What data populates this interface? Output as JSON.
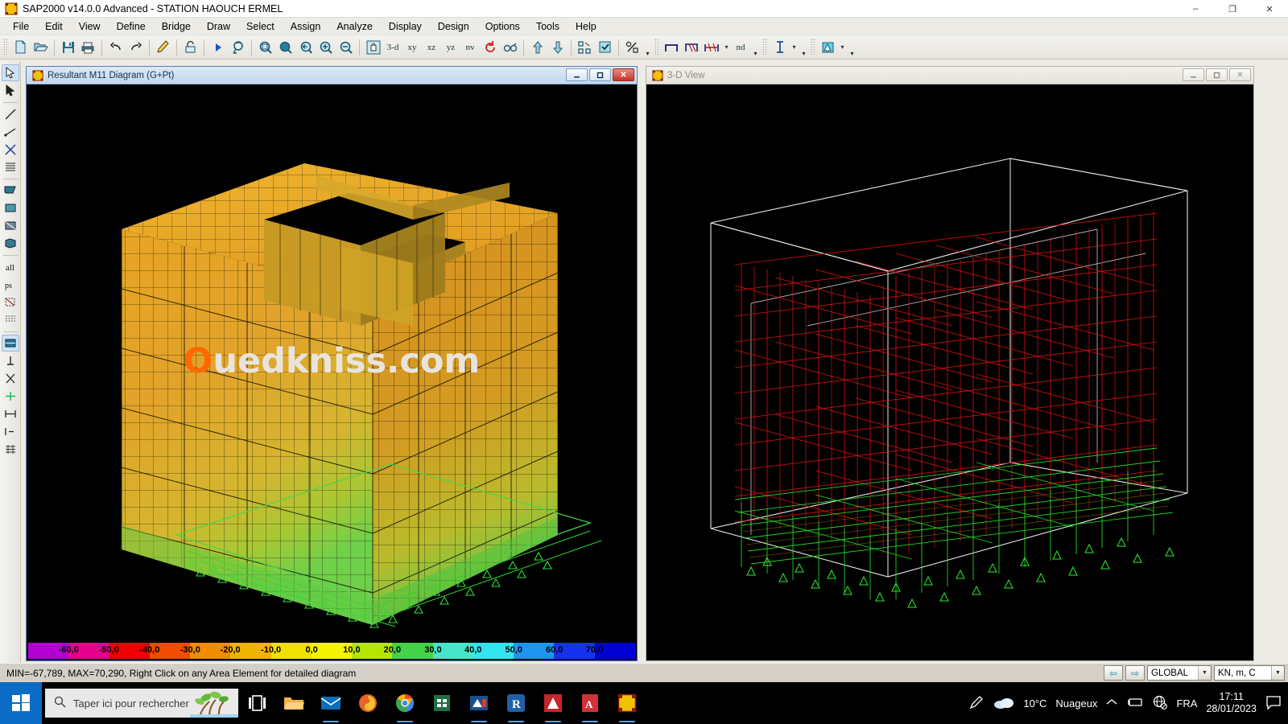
{
  "window": {
    "title": "SAP2000 v14.0.0 Advanced  - STATION HAOUCH ERMEL",
    "app_icon": "sap2000-icon",
    "minimize": "–",
    "maximize": "❐",
    "close": "✕"
  },
  "menu": {
    "items": [
      {
        "label": "File",
        "accel": "F"
      },
      {
        "label": "Edit",
        "accel": "E"
      },
      {
        "label": "View",
        "accel": "V"
      },
      {
        "label": "Define",
        "accel": "D"
      },
      {
        "label": "Bridge",
        "accel": "B"
      },
      {
        "label": "Draw",
        "accel": "a"
      },
      {
        "label": "Select",
        "accel": "S"
      },
      {
        "label": "Assign",
        "accel": "A"
      },
      {
        "label": "Analyze",
        "accel": "n"
      },
      {
        "label": "Display",
        "accel": "y"
      },
      {
        "label": "Design",
        "accel": "g"
      },
      {
        "label": "Options",
        "accel": "O"
      },
      {
        "label": "Tools",
        "accel": "T"
      },
      {
        "label": "Help",
        "accel": "H"
      }
    ]
  },
  "toolbar": {
    "view_3d_label": "3-d",
    "view_xy_label": "xy",
    "view_xz_label": "xz",
    "view_yz_label": "yz",
    "view_nv_label": "nv",
    "view_nd_label": "nd",
    "icons": [
      "new-file-icon",
      "open-folder-icon",
      "save-icon",
      "print-icon",
      "undo-icon",
      "redo-icon",
      "refresh-pencil-icon",
      "lock-icon",
      "run-analysis-icon",
      "rubber-band-zoom-icon",
      "zoom-in-icon",
      "zoom-out-icon",
      "previous-zoom-icon",
      "zoom-full-icon",
      "zoom-window-icon",
      "pan-icon",
      "move-up-icon",
      "move-down-icon",
      "set-elements-icon",
      "display-options-icon",
      "scale-icon",
      "moment-diagram-icon",
      "shear-diagram-icon",
      "axial-diagram-icon",
      "section-cut-icon",
      "assign-frame-icon",
      "fill-icon"
    ]
  },
  "left_rail": {
    "icons": [
      "pointer-icon",
      "select-pointer-icon",
      "draw-line-icon",
      "draw-frame-icon",
      "draw-special-joint-icon",
      "quick-draw-line-icon",
      "draw-area-icon",
      "quick-draw-area-icon",
      "draw-section-icon",
      "select-all-icon",
      "select-previous-icon",
      "deselect-icon",
      "clear-selection-icon",
      "assign-joint-icon",
      "assign-restraint-icon",
      "mesh-icon",
      "constraint-icon",
      "divide-icon",
      "snap-icon",
      "snap-mid-icon",
      "snap-intersection-icon",
      "snap-perpendicular-icon",
      "snap-grid-icon"
    ]
  },
  "left_window": {
    "title": "Resultant M11 Diagram   (G+Pt)",
    "icon": "sap2000-icon",
    "active": true,
    "buttons": {
      "minimize": "–",
      "restore": "❐",
      "close": "✕"
    }
  },
  "right_window": {
    "title": "3-D View",
    "icon": "sap2000-icon",
    "active": false,
    "buttons": {
      "minimize": "–",
      "restore": "❐",
      "close": "✕"
    }
  },
  "watermark": {
    "prefix": "O",
    "rest": "uedkniss.com",
    "accent_color": "#ff6a00"
  },
  "legend": {
    "labels": [
      "-60,0",
      "-50,0",
      "-40,0",
      "-30,0",
      "-20,0",
      "-10,0",
      "0,0",
      "10,0",
      "20,0",
      "30,0",
      "40,0",
      "50,0",
      "60,0",
      "70,0"
    ],
    "colors": [
      "#b400d2",
      "#e6008c",
      "#f00000",
      "#f04b00",
      "#f08c00",
      "#f0b400",
      "#f0e100",
      "#f5f500",
      "#b4e600",
      "#46d246",
      "#46e6c8",
      "#32e6f0",
      "#1e96f0",
      "#1432f0",
      "#0000d2"
    ]
  },
  "status": {
    "message": "MIN=-67,789, MAX=70,290, Right Click on any Area Element for detailed diagram",
    "coord_system": "GLOBAL",
    "units": "KN, m, C",
    "nav_back": "⇦",
    "nav_forward": "⇨"
  },
  "taskbar": {
    "start": "windows-start-icon",
    "search_placeholder": "Taper ici pour rechercher",
    "task_view": "task-view-icon",
    "apps": [
      {
        "name": "file-explorer-icon",
        "running": false
      },
      {
        "name": "mail-icon",
        "running": true
      },
      {
        "name": "firefox-icon",
        "running": false
      },
      {
        "name": "google-chrome-icon",
        "running": true
      },
      {
        "name": "excel-icon",
        "running": false
      },
      {
        "name": "autocad-icon",
        "running": true
      },
      {
        "name": "rstudio-icon",
        "running": true
      },
      {
        "name": "autodesk-icon",
        "running": true
      },
      {
        "name": "adobe-reader-icon",
        "running": true
      },
      {
        "name": "sap2000-icon",
        "running": true
      }
    ],
    "tray": {
      "pen_icon": "pen-icon",
      "weather_icon": "cloud-icon",
      "temperature": "10°C",
      "weather_text": "Nuageux",
      "chevron": "show-hidden-icons",
      "battery_icon": "battery-icon",
      "network_icon": "network-disconnected-icon",
      "language": "FRA",
      "time": "17:11",
      "date": "28/01/2023",
      "action_center": "notifications-icon"
    }
  }
}
